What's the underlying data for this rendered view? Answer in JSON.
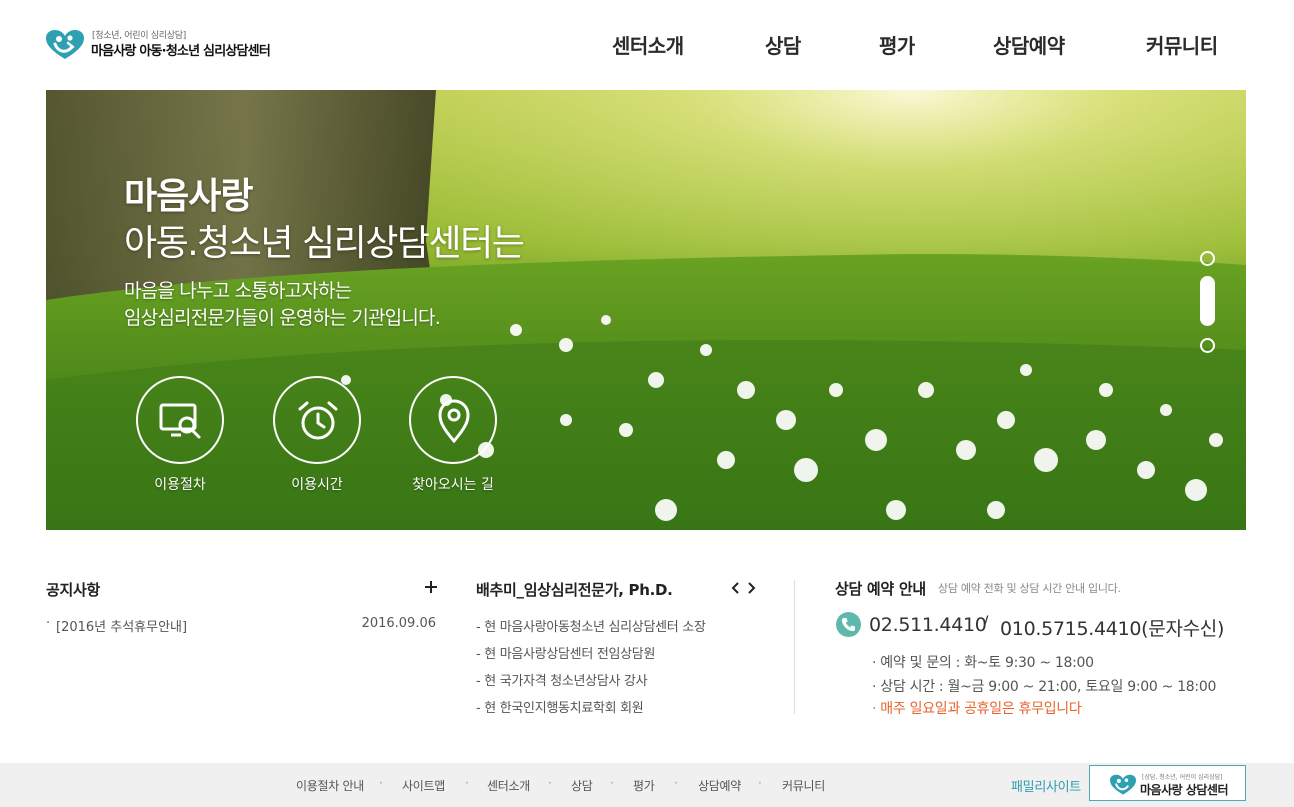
{
  "header": {
    "logo_subtitle": "[청소년, 어린이 심리상담]",
    "logo_name": "마음사랑 아동·청소년 심리상담센터",
    "nav": [
      "센터소개",
      "상담",
      "평가",
      "상담예약",
      "커뮤니티"
    ]
  },
  "visual": {
    "title_line1": "마음사랑",
    "title_line2": "아동.청소년 심리상담센터는",
    "desc_line1": "마음을 나누고 소통하고자하는",
    "desc_line2": "임상심리전문가들이 운영하는 기관입니다.",
    "quick_links": [
      {
        "label": "이용절차",
        "icon": "screen-search-icon"
      },
      {
        "label": "이용시간",
        "icon": "alarm-clock-icon"
      },
      {
        "label": "찾아오시는 길",
        "icon": "map-pin-icon"
      }
    ]
  },
  "notice": {
    "title": "공지사항",
    "items": [
      {
        "text": "[2016년 추석휴무안내]",
        "date": "2016.09.06"
      }
    ]
  },
  "profile": {
    "title": "배추미_임상심리전문가, Ph.D.",
    "items": [
      "- 현 마음사랑아동청소년 심리상담센터 소장",
      "- 현 마음사랑상담센터 전임상담원",
      "- 현 국가자격 청소년상담사 강사",
      "- 현 한국인지행동치료학회 회원"
    ]
  },
  "reservation": {
    "title": "상담 예약 안내",
    "subtitle": "상담 예약 전화 및 상담 시간 안내 입니다.",
    "phone1": "02.511.4410",
    "separator": "/",
    "phone2": "010.5715.4410(문자수신)",
    "lines": [
      "· 예약 및 문의 : 화~토 9:30 ~ 18:00",
      "· 상담 시간 : 월~금 9:00 ~ 21:00, 토요일 9:00 ~ 18:00"
    ],
    "closed_notice": "· 매주 일요일과 공휴일은 휴무입니다",
    "accent_color": "#e8632c"
  },
  "footer": {
    "nav": [
      "이용절차 안내",
      "사이트맵",
      "센터소개",
      "상담",
      "평가",
      "상담예약",
      "커뮤니티"
    ],
    "family_label": "패밀리사이트",
    "family_sub": "[상담, 청소년, 어린이 심리상담]",
    "family_name": "마음사랑 상담센터"
  },
  "colors": {
    "brand_teal": "#4aa8b8",
    "phone_icon": "#5fb8ac"
  }
}
